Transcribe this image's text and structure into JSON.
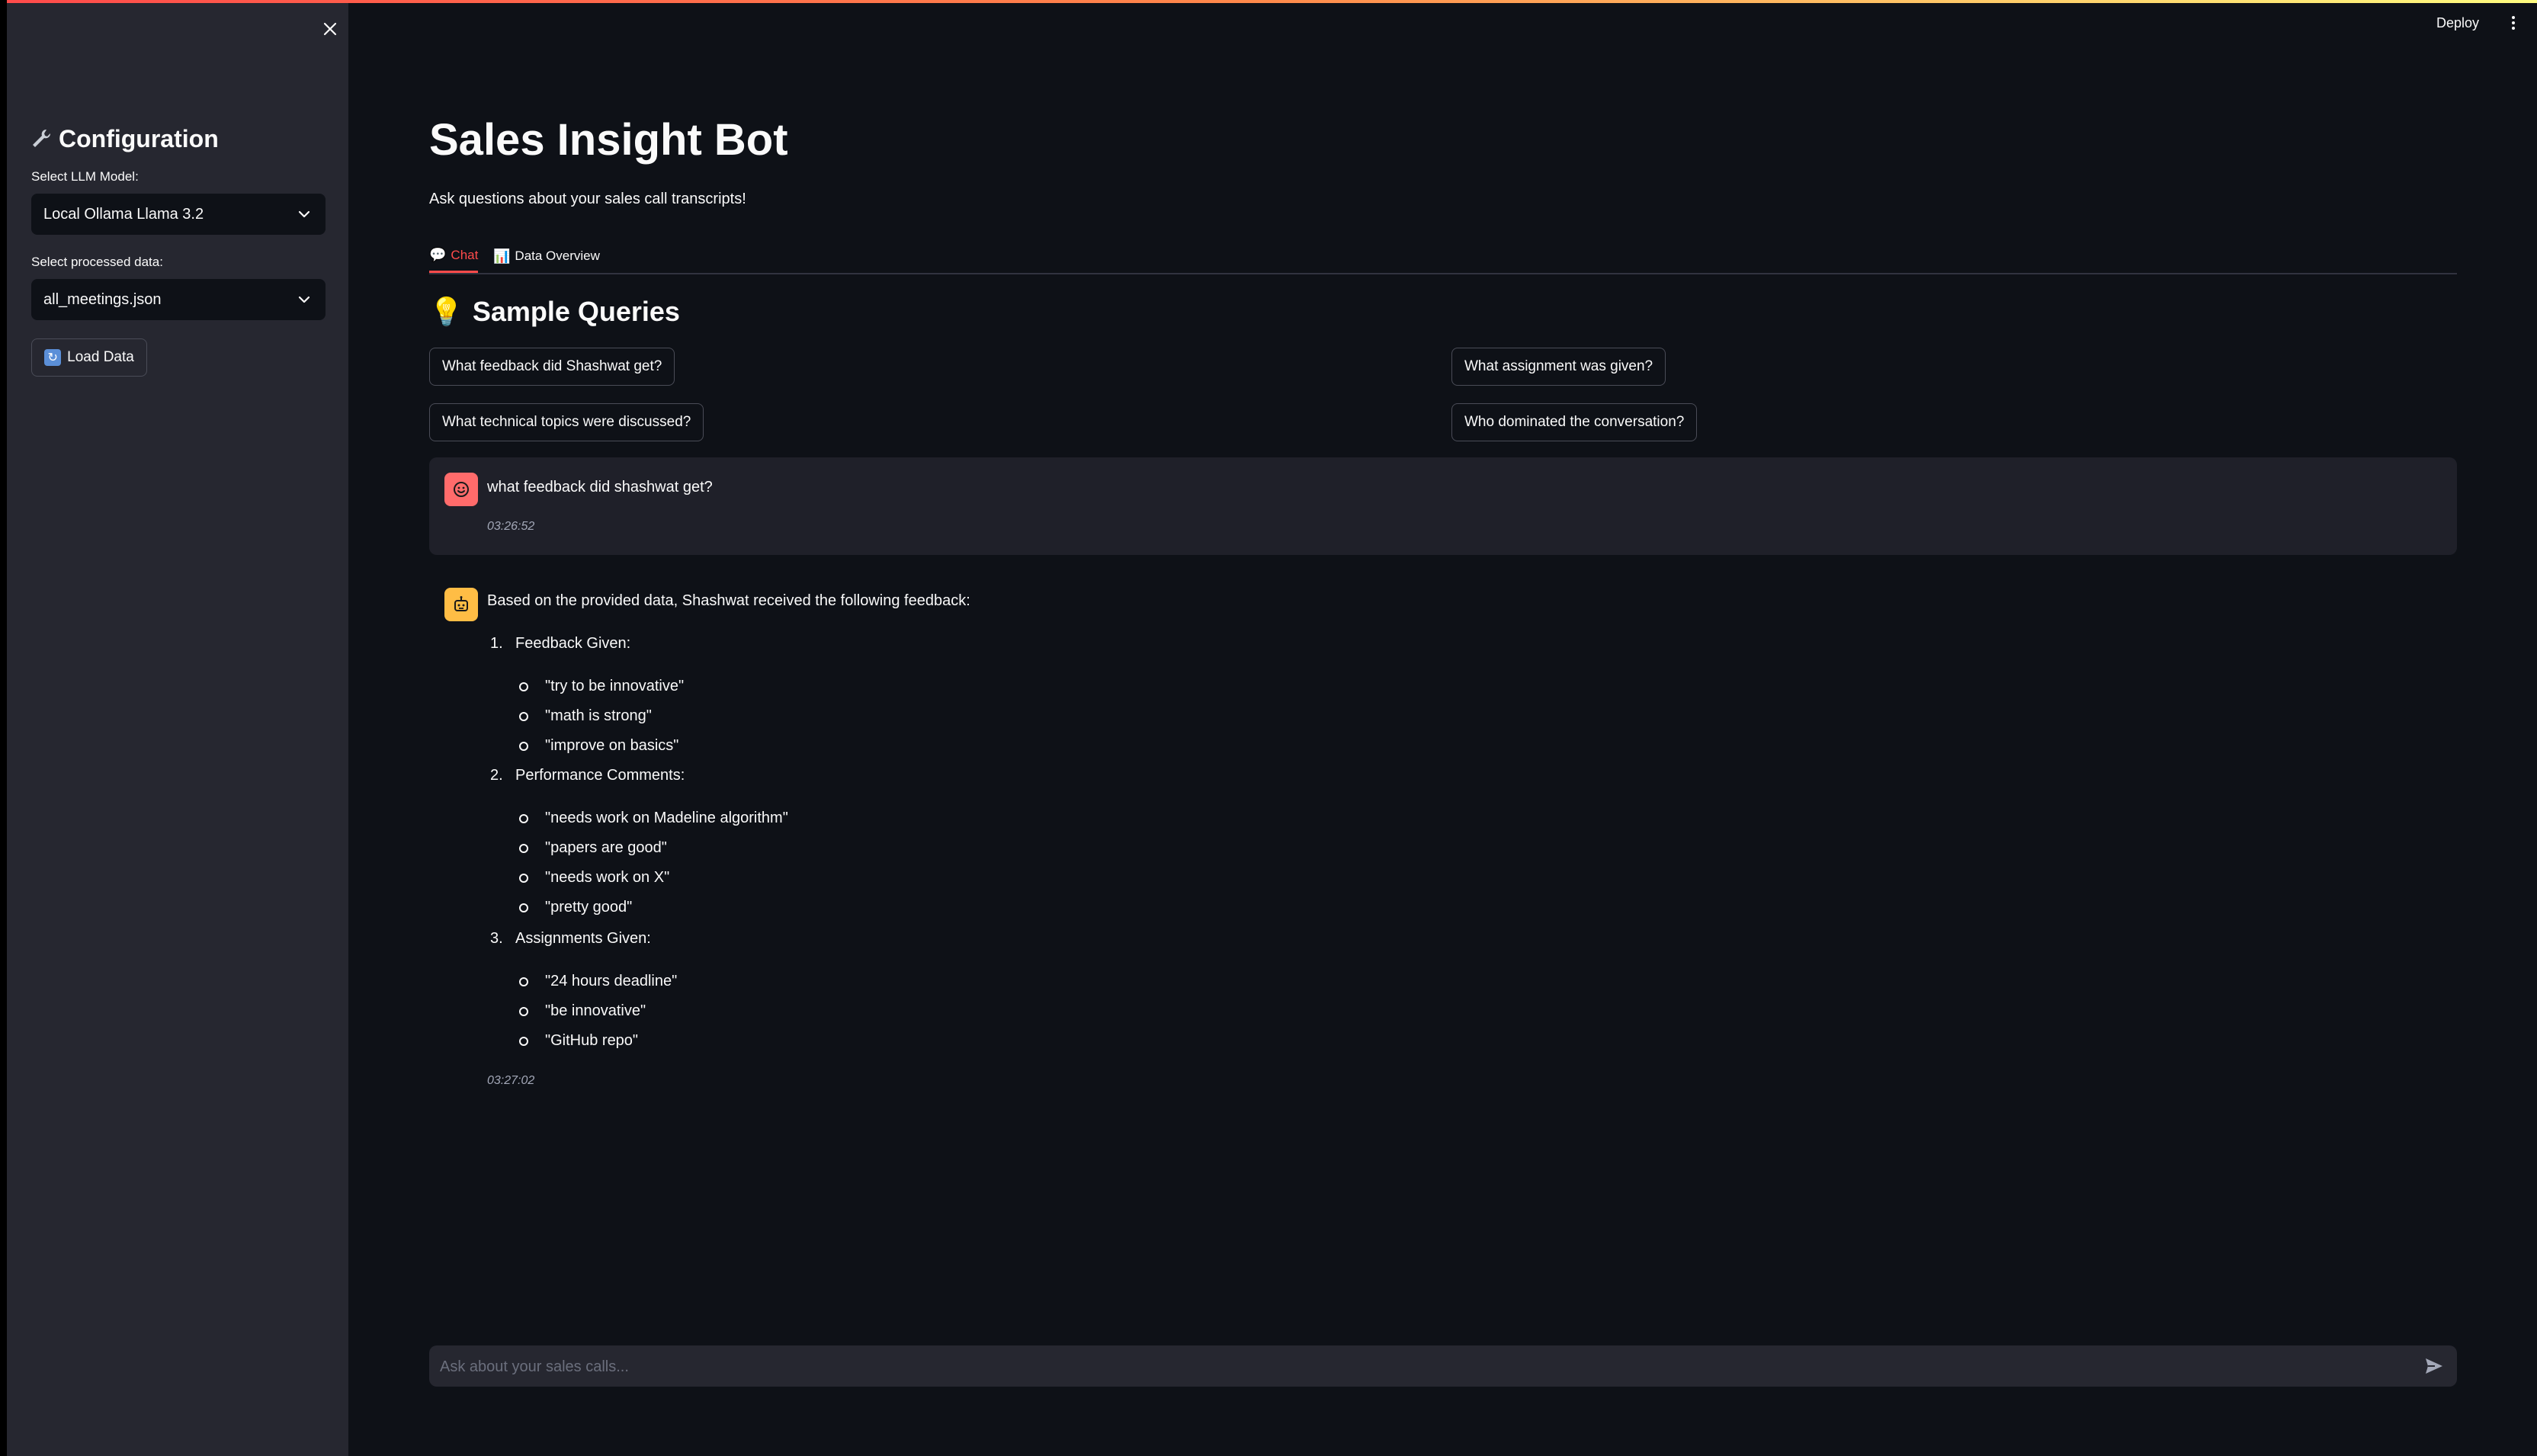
{
  "header": {
    "deploy_label": "Deploy"
  },
  "sidebar": {
    "heading": "Configuration",
    "model_label": "Select LLM Model:",
    "model_value": "Local Ollama Llama 3.2",
    "data_label": "Select processed data:",
    "data_value": "all_meetings.json",
    "load_button": "Load Data"
  },
  "main": {
    "title": "Sales Insight Bot",
    "subtitle": "Ask questions about your sales call transcripts!",
    "tabs": [
      {
        "label": "Chat",
        "icon": "speech-bubble-icon",
        "active": true
      },
      {
        "label": "Data Overview",
        "icon": "bar-chart-icon",
        "active": false
      }
    ],
    "sample_heading": "Sample Queries",
    "sample_queries": [
      "What feedback did Shashwat get?",
      "What assignment was given?",
      "What technical topics were discussed?",
      "Who dominated the conversation?"
    ]
  },
  "chat": {
    "user_message": "what feedback did shashwat get?",
    "user_time": "03:26:52",
    "assistant_intro": "Based on the provided data, Shashwat received the following feedback:",
    "sections": [
      {
        "number": "1.",
        "title": "Feedback Given:",
        "items": [
          "\"try to be innovative\"",
          "\"math is strong\"",
          "\"improve on basics\""
        ]
      },
      {
        "number": "2.",
        "title": "Performance Comments:",
        "items": [
          "\"needs work on Madeline algorithm\"",
          "\"papers are good\"",
          "\"needs work on X\"",
          "\"pretty good\""
        ]
      },
      {
        "number": "3.",
        "title": "Assignments Given:",
        "items": [
          "\"24 hours deadline\"",
          "\"be innovative\"",
          "\"GitHub repo\""
        ]
      }
    ],
    "assistant_time": "03:27:02",
    "input_placeholder": "Ask about your sales calls..."
  },
  "colors": {
    "accent": "#ff4b4b",
    "background": "#0e1117",
    "sidebar": "#262730",
    "user_avatar": "#ff6b6b",
    "assistant_avatar": "#ffbd45"
  }
}
